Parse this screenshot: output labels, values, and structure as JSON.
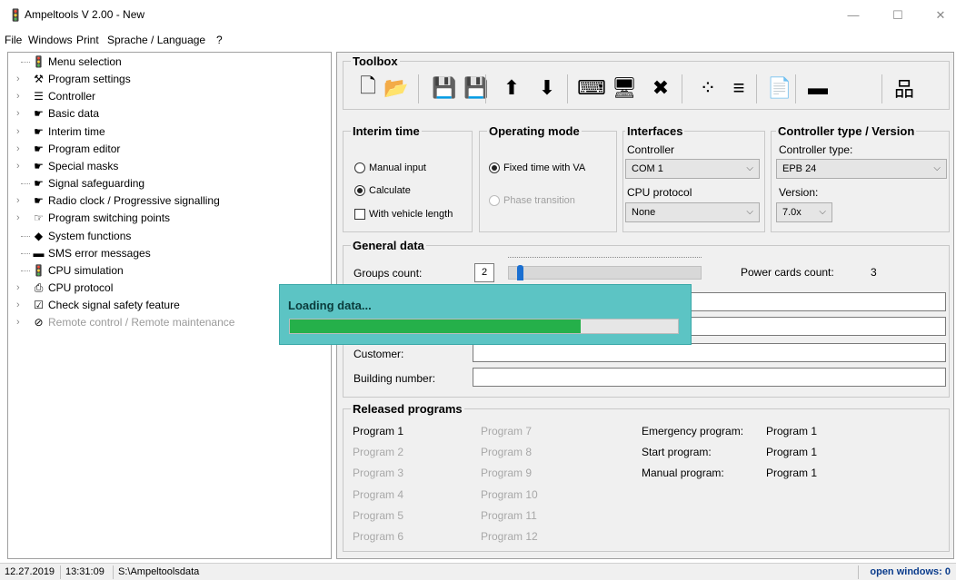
{
  "window": {
    "title": "Ampeltools V 2.00 - New",
    "minimize": "—",
    "maximize": "☐",
    "close": "✕"
  },
  "menu": [
    "File",
    "Windows",
    "Print",
    "Sprache / Language",
    "?"
  ],
  "tree": [
    {
      "label": "Menu selection",
      "icon": "traffic-light-icon",
      "glyph": "🚦",
      "expandable": false,
      "disabled": false
    },
    {
      "label": "Program settings",
      "icon": "tools-icon",
      "glyph": "⚒",
      "expandable": true,
      "disabled": false
    },
    {
      "label": "Controller",
      "icon": "controller-icon",
      "glyph": "☰",
      "expandable": true,
      "disabled": false
    },
    {
      "label": "Basic data",
      "icon": "hand-pointer-icon",
      "glyph": "☛",
      "expandable": true,
      "disabled": false
    },
    {
      "label": "Interim time",
      "icon": "hand-pointer-icon",
      "glyph": "☛",
      "expandable": true,
      "disabled": false
    },
    {
      "label": "Program editor",
      "icon": "hand-pointer-icon",
      "glyph": "☛",
      "expandable": true,
      "disabled": false
    },
    {
      "label": "Special masks",
      "icon": "hand-pointer-icon",
      "glyph": "☛",
      "expandable": true,
      "disabled": false
    },
    {
      "label": "Signal safeguarding",
      "icon": "hand-pointer-icon",
      "glyph": "☛",
      "expandable": false,
      "disabled": false
    },
    {
      "label": "Radio clock / Progressive signalling",
      "icon": "hand-pointer-icon",
      "glyph": "☛",
      "expandable": true,
      "disabled": false
    },
    {
      "label": "Program switching points",
      "icon": "hand-pointer-icon",
      "glyph": "☞",
      "expandable": true,
      "disabled": false
    },
    {
      "label": "System functions",
      "icon": "diamond-icon",
      "glyph": "◆",
      "expandable": false,
      "disabled": false
    },
    {
      "label": "SMS error messages",
      "icon": "sms-device-icon",
      "glyph": "▬",
      "expandable": false,
      "disabled": false
    },
    {
      "label": "CPU simulation",
      "icon": "traffic-light-icon",
      "glyph": "🚦",
      "expandable": false,
      "disabled": false
    },
    {
      "label": "CPU protocol",
      "icon": "printer-icon",
      "glyph": "⎙",
      "expandable": true,
      "disabled": false
    },
    {
      "label": "Check signal safety feature",
      "icon": "checklist-icon",
      "glyph": "☑",
      "expandable": true,
      "disabled": false
    },
    {
      "label": "Remote control / Remote maintenance",
      "icon": "blocked-icon",
      "glyph": "⊘",
      "expandable": true,
      "disabled": true
    }
  ],
  "toolbox": {
    "title": "Toolbox",
    "buttons": [
      {
        "name": "new-file-icon",
        "glyph": "🗋"
      },
      {
        "name": "open-folder-icon",
        "glyph": "📂"
      },
      {
        "name": "save-icon",
        "glyph": "💾"
      },
      {
        "name": "save-as-icon",
        "glyph": "💾"
      },
      {
        "name": "upload-icon",
        "glyph": "⬆"
      },
      {
        "name": "download-icon",
        "glyph": "⬇"
      },
      {
        "name": "keyboard-icon",
        "glyph": "⌨"
      },
      {
        "name": "monitor-icon",
        "glyph": "🖥"
      },
      {
        "name": "disconnect-icon",
        "glyph": "✖"
      },
      {
        "name": "signal-dots-icon",
        "glyph": "⁘"
      },
      {
        "name": "list-lines-icon",
        "glyph": "≡"
      },
      {
        "name": "document-icon",
        "glyph": "📄"
      },
      {
        "name": "modem-icon",
        "glyph": "▬"
      },
      {
        "name": "network-icon",
        "glyph": "品"
      }
    ]
  },
  "interim_time": {
    "title": "Interim time",
    "manual_input": "Manual input",
    "calculate": "Calculate",
    "with_vehicle_length": "With vehicle length"
  },
  "operating_mode": {
    "title": "Operating mode",
    "fixed_time": "Fixed time with VA",
    "phase_transition": "Phase transition"
  },
  "interfaces": {
    "title": "Interfaces",
    "controller_label": "Controller",
    "controller_value": "COM 1",
    "cpu_protocol_label": "CPU protocol",
    "cpu_protocol_value": "None"
  },
  "controller_type": {
    "title": "Controller type / Version",
    "type_label": "Controller type:",
    "type_value": "EPB 24",
    "version_label": "Version:",
    "version_value": "7.0x"
  },
  "general_data": {
    "title": "General data",
    "groups_count_label": "Groups count:",
    "groups_count_value": "2",
    "power_cards_label": "Power cards count:",
    "power_cards_value": "3",
    "customer_label": "Customer:",
    "building_number_label": "Building number:",
    "slider_fraction": 0.04
  },
  "released_programs": {
    "title": "Released programs",
    "col1": [
      {
        "label": "Program 1",
        "active": true
      },
      {
        "label": "Program 2",
        "active": false
      },
      {
        "label": "Program 3",
        "active": false
      },
      {
        "label": "Program 4",
        "active": false
      },
      {
        "label": "Program 5",
        "active": false
      },
      {
        "label": "Program 6",
        "active": false
      }
    ],
    "col2": [
      {
        "label": "Program 7",
        "active": false
      },
      {
        "label": "Program 8",
        "active": false
      },
      {
        "label": "Program 9",
        "active": false
      },
      {
        "label": "Program 10",
        "active": false
      },
      {
        "label": "Program 11",
        "active": false
      },
      {
        "label": "Program 12",
        "active": false
      }
    ],
    "emergency_label": "Emergency program:",
    "emergency_value": "Program 1",
    "start_label": "Start program:",
    "start_value": "Program 1",
    "manual_label": "Manual program:",
    "manual_value": "Program 1"
  },
  "loading": {
    "text": "Loading data...",
    "progress": 0.75
  },
  "status": {
    "date": "12.27.2019",
    "time": "13:31:09",
    "path": "S:\\Ampeltoolsdata",
    "open_windows": "open windows: 0"
  },
  "colors": {
    "progress_fill": "#25b04a",
    "loading_bg": "#5cc4c4",
    "status_accent": "#0b3c8c"
  }
}
